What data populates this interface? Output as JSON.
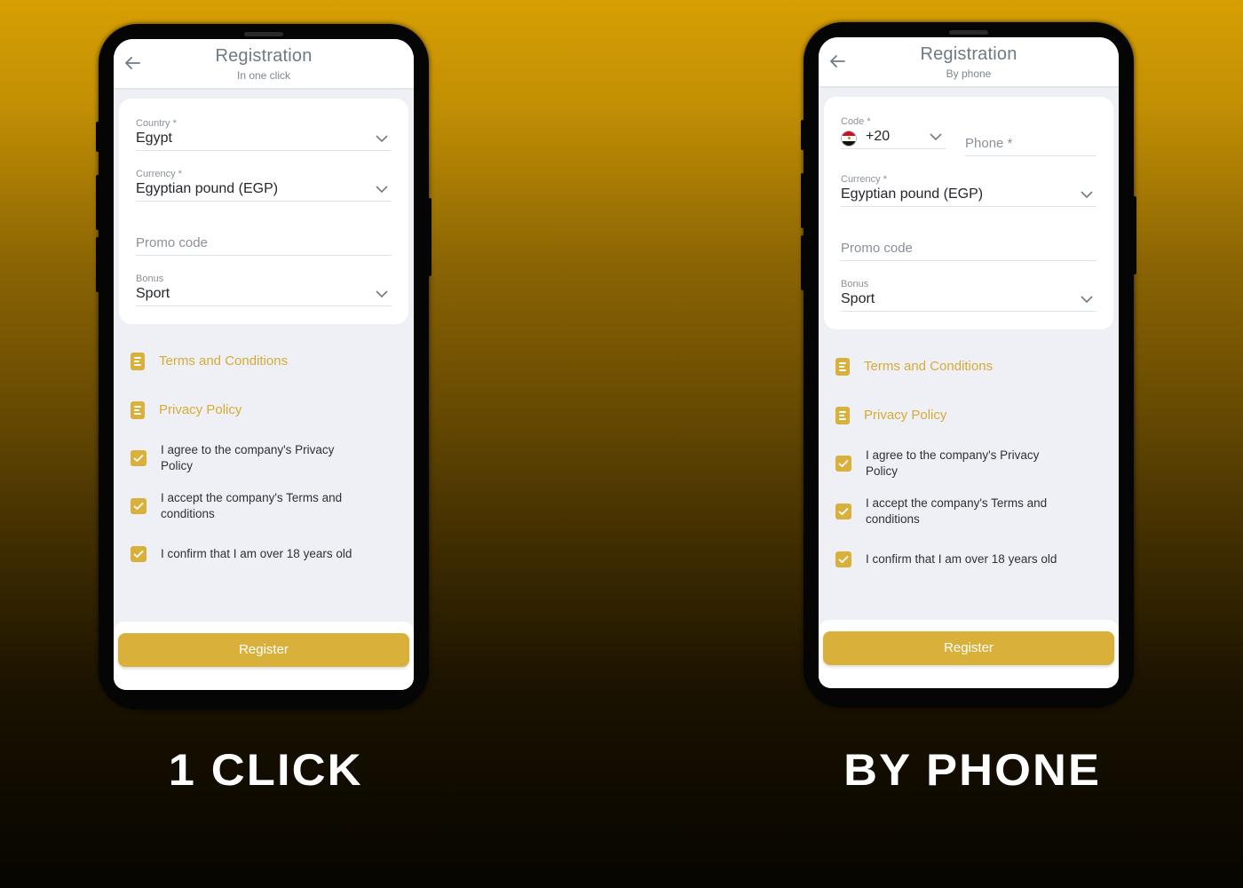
{
  "screens": [
    {
      "header": {
        "title": "Registration",
        "subtitle": "In one click"
      },
      "fields": {
        "country": {
          "label": "Country *",
          "value": "Egypt"
        },
        "currency": {
          "label": "Currency *",
          "value": "Egyptian pound (EGP)"
        },
        "promo": {
          "placeholder": "Promo code"
        },
        "bonus": {
          "label": "Bonus",
          "value": "Sport"
        }
      },
      "links": [
        {
          "label": "Terms and Conditions",
          "icon": "document-icon"
        },
        {
          "label": "Privacy Policy",
          "icon": "document-icon"
        }
      ],
      "checks": [
        {
          "label": "I agree to the company's Privacy Policy",
          "checked": true
        },
        {
          "label": "I accept the company's Terms and conditions",
          "checked": true
        },
        {
          "label": "I confirm that I am over 18 years old",
          "checked": true
        }
      ],
      "register_label": "Register",
      "caption": "1 CLICK"
    },
    {
      "header": {
        "title": "Registration",
        "subtitle": "By phone"
      },
      "fields": {
        "code": {
          "label": "Code *",
          "value": "+20",
          "flag": "egypt-flag"
        },
        "phone": {
          "placeholder": "Phone *"
        },
        "currency": {
          "label": "Currency *",
          "value": "Egyptian pound (EGP)"
        },
        "promo": {
          "placeholder": "Promo code"
        },
        "bonus": {
          "label": "Bonus",
          "value": "Sport"
        }
      },
      "links": [
        {
          "label": "Terms and Conditions",
          "icon": "document-icon"
        },
        {
          "label": "Privacy Policy",
          "icon": "document-icon"
        }
      ],
      "checks": [
        {
          "label": "I agree to the company's Privacy Policy",
          "checked": true
        },
        {
          "label": "I accept the company's Terms and conditions",
          "checked": true
        },
        {
          "label": "I confirm that I am over 18 years old",
          "checked": true
        }
      ],
      "register_label": "Register",
      "caption": "BY PHONE"
    }
  ],
  "colors": {
    "accent": "#d9b13a",
    "link": "#d6ab35",
    "background_top": "#d79f03",
    "background_bottom": "#070500"
  }
}
